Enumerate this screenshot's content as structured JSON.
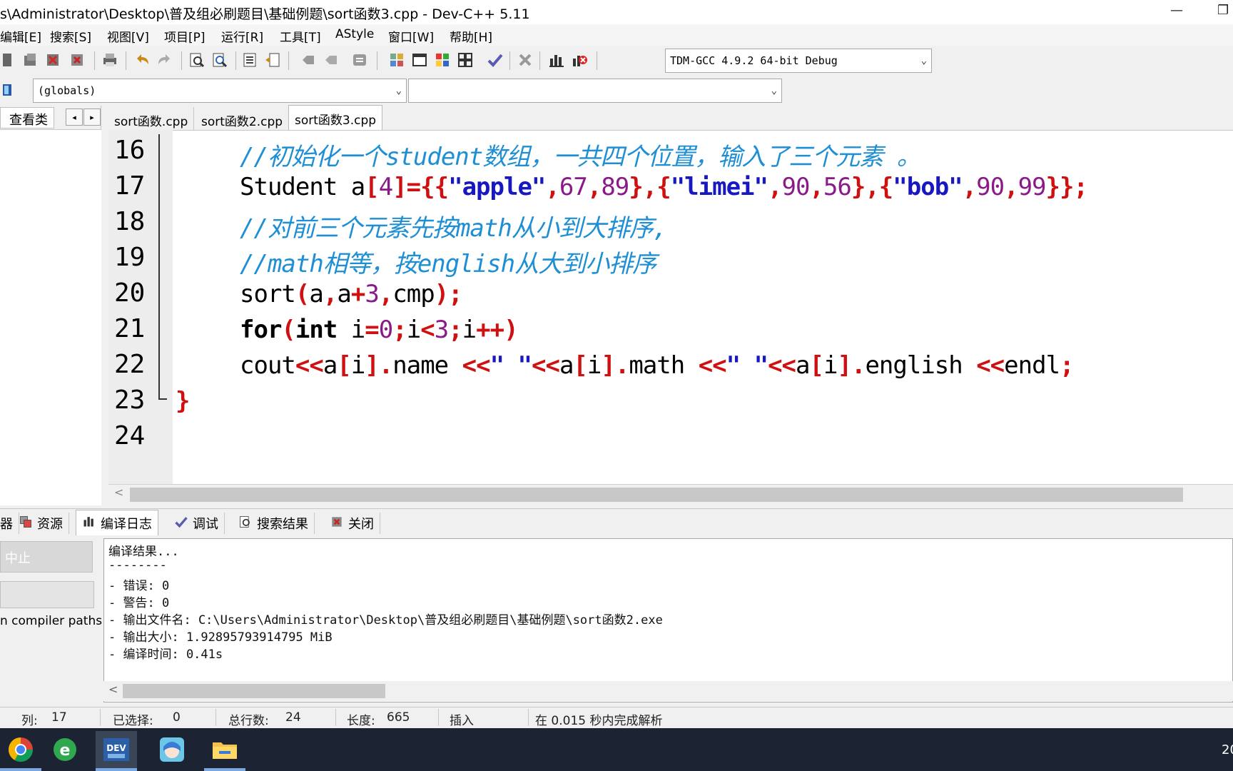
{
  "window": {
    "title": "s\\Administrator\\Desktop\\普及组必刷题目\\基础例题\\sort函数3.cpp - Dev-C++ 5.11",
    "minimize": "—",
    "restore": "❐"
  },
  "menu": {
    "items": [
      "编辑[E]",
      "搜索[S]",
      "视图[V]",
      "项目[P]",
      "运行[R]",
      "工具[T]",
      "AStyle",
      "窗口[W]",
      "帮助[H]"
    ]
  },
  "toolbar": {
    "compiler": "TDM-GCC 4.9.2 64-bit Debug",
    "scope": "(globals)",
    "member": ""
  },
  "left_panel": {
    "tab": "查看类",
    "prev": "◂",
    "next": "▸"
  },
  "editor": {
    "tabs": [
      "sort函数.cpp",
      "sort函数2.cpp",
      "sort函数3.cpp"
    ],
    "active_tab": 2,
    "line_numbers": [
      "16",
      "17",
      "18",
      "19",
      "20",
      "21",
      "22",
      "23",
      "24"
    ],
    "lines": {
      "l16": "//初始化一个student数组，一共四个位置，输入了三个元素 。",
      "l17": {
        "a": "Student a",
        "b": "[",
        "c": "4",
        "d": "]={{",
        "e": "\"apple\"",
        "f": ",",
        "g": "67",
        "h": ",",
        "i": "89",
        "j": "},{",
        "k": "\"limei\"",
        "l": ",",
        "m": "90",
        "n": ",",
        "o": "56",
        "p": "},{",
        "q": "\"bob\"",
        "r": ",",
        "s": "90",
        "t": ",",
        "u": "99",
        "v": "}};"
      },
      "l18": "//对前三个元素先按math从小到大排序,",
      "l19": "//math相等，按english从大到小排序",
      "l20": {
        "a": "sort",
        "b": "(",
        "c": "a",
        "d": ",",
        "e": "a",
        "f": "+",
        "g": "3",
        "h": ",",
        "i": "cmp",
        "j": ");"
      },
      "l21": {
        "a": "for",
        "b": "(",
        "c": "int",
        "d": " i",
        "e": "=",
        "f": "0",
        "g": ";",
        "h": "i",
        "i": "<",
        "j": "3",
        "k": ";",
        "l": "i",
        "m": "++",
        "n": ")"
      },
      "l22": {
        "a": "cout",
        "b": "<<",
        "c": "a",
        "d": "[",
        "e": "i",
        "f": "].",
        "g": "name ",
        "h": "<<",
        "i": "\" \"",
        "j": "<<",
        "k": "a",
        "l": "[",
        "m": "i",
        "n": "].",
        "o": "math ",
        "p": "<<",
        "q": "\" \"",
        "r": "<<",
        "s": "a",
        "t": "[",
        "u": "i",
        "v": "].",
        "w": "english ",
        "x": "<<",
        "y": "endl",
        "z": ";"
      },
      "l23": "}"
    },
    "scroll_left": "<"
  },
  "bottom_tabs": [
    "器",
    "资源",
    "编译日志",
    "调试",
    "搜索结果",
    "关闭"
  ],
  "bottom_left": {
    "stop_button": "中止",
    "label": "n compiler paths"
  },
  "compile_log": {
    "lines": [
      "编译结果...",
      "--------",
      "- 错误: 0",
      "- 警告: 0",
      "- 输出文件名: C:\\Users\\Administrator\\Desktop\\普及组必刷题目\\基础例题\\sort函数2.exe",
      "- 输出大小: 1.92895793914795 MiB",
      "- 编译时间: 0.41s"
    ],
    "scroll_left": "<"
  },
  "status": {
    "col_label": "列:",
    "col_value": "17",
    "sel_label": "已选择:",
    "sel_value": "0",
    "lines_label": "总行数:",
    "lines_value": "24",
    "len_label": "长度:",
    "len_value": "665",
    "mode": "插入",
    "parse": "在 0.015 秒内完成解析"
  },
  "taskbar": {
    "clock": "20",
    "dev_label": "DEV"
  },
  "colors": {
    "comment": "#1e8fd4",
    "symbol": "#d01010",
    "number": "#8a1a8a",
    "string": "#1818c0"
  }
}
